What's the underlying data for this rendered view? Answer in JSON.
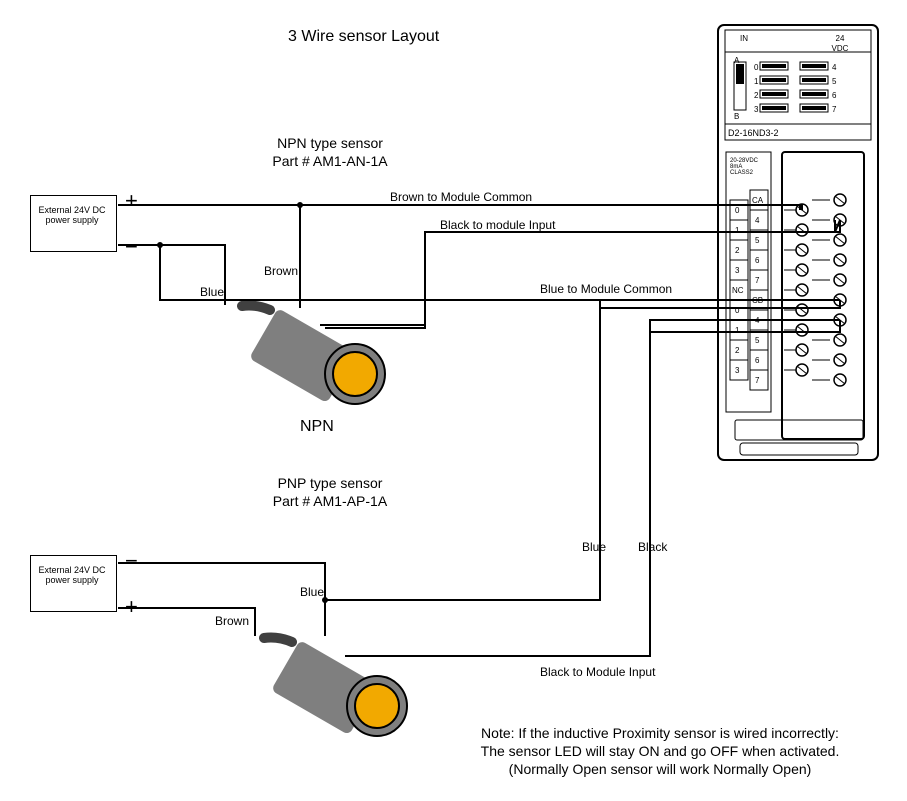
{
  "title": "3 Wire sensor Layout",
  "module": {
    "in_label": "IN",
    "vdc_top": "24",
    "vdc_bottom": "VDC",
    "a": "A",
    "b": "B",
    "leds_left": [
      "0",
      "1",
      "2",
      "3"
    ],
    "leds_right": [
      "4",
      "5",
      "6",
      "7"
    ],
    "model": "D2-16ND3-2",
    "term_small_label": "20-28VDC\n8mA\nCLASS2",
    "terms_left_a": [
      "0",
      "1",
      "2",
      "3",
      "NC",
      "0",
      "1",
      "2",
      "3"
    ],
    "terms_right_a": [
      "CA",
      "4",
      "5",
      "6",
      "7",
      "CB",
      "4",
      "5",
      "6",
      "7"
    ]
  },
  "npn": {
    "heading1": "NPN type sensor",
    "heading2": "Part # AM1-AN-1A",
    "label": "NPN",
    "psu": "External 24V DC power supply",
    "plus": "+",
    "minus": "−",
    "wire_brown_common": "Brown to Module Common",
    "wire_black_input": "Black to module Input",
    "wire_blue_common": "Blue to Module Common",
    "wire_brown": "Brown",
    "wire_blue": "Blue"
  },
  "pnp": {
    "heading1": "PNP type sensor",
    "heading2": "Part # AM1-AP-1A",
    "psu": "External 24V DC power supply",
    "plus": "+",
    "minus": "−",
    "wire_blue": "Blue",
    "wire_brown": "Brown",
    "wire_blue_lbl": "Blue",
    "wire_black_lbl": "Black",
    "wire_black_input": "Black to Module Input"
  },
  "note": {
    "l1": "Note: If the inductive Proximity sensor is wired incorrectly:",
    "l2": "The sensor LED will stay ON and go OFF when activated.",
    "l3": "(Normally Open sensor will work Normally Open)"
  }
}
